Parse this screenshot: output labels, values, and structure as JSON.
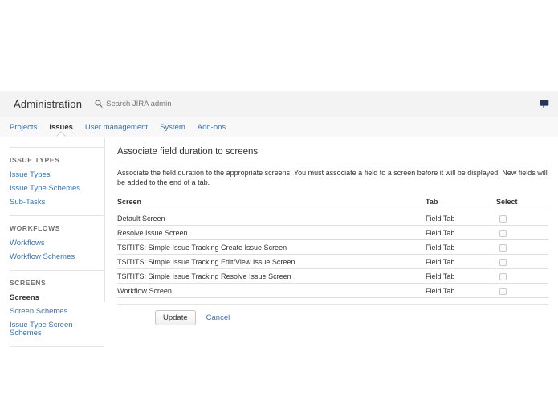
{
  "header": {
    "title": "Administration",
    "search_placeholder": "Search JIRA admin"
  },
  "nav": {
    "tabs": [
      {
        "label": "Projects",
        "active": false
      },
      {
        "label": "Issues",
        "active": true
      },
      {
        "label": "User management",
        "active": false
      },
      {
        "label": "System",
        "active": false
      },
      {
        "label": "Add-ons",
        "active": false
      }
    ]
  },
  "sidebar": {
    "sections": [
      {
        "title": "ISSUE TYPES",
        "items": [
          {
            "label": "Issue Types",
            "active": false
          },
          {
            "label": "Issue Type Schemes",
            "active": false
          },
          {
            "label": "Sub-Tasks",
            "active": false
          }
        ]
      },
      {
        "title": "WORKFLOWS",
        "items": [
          {
            "label": "Workflows",
            "active": false
          },
          {
            "label": "Workflow Schemes",
            "active": false
          }
        ]
      },
      {
        "title": "SCREENS",
        "items": [
          {
            "label": "Screens",
            "active": true
          },
          {
            "label": "Screen Schemes",
            "active": false
          },
          {
            "label": "Issue Type Screen Schemes",
            "active": false
          }
        ]
      }
    ]
  },
  "main": {
    "title": "Associate field duration to screens",
    "description": "Associate the field duration to the appropriate screens. You must associate a field to a screen before it will be displayed. New fields will be added to the end of a tab.",
    "table": {
      "headers": [
        "Screen",
        "Tab",
        "Select"
      ],
      "rows": [
        {
          "screen": "Default Screen",
          "tab": "Field Tab",
          "selected": false
        },
        {
          "screen": "Resolve Issue Screen",
          "tab": "Field Tab",
          "selected": false
        },
        {
          "screen": "TSITITS: Simple Issue Tracking Create Issue Screen",
          "tab": "Field Tab",
          "selected": false
        },
        {
          "screen": "TSITITS: Simple Issue Tracking Edit/View Issue Screen",
          "tab": "Field Tab",
          "selected": false
        },
        {
          "screen": "TSITITS: Simple Issue Tracking Resolve Issue Screen",
          "tab": "Field Tab",
          "selected": false
        },
        {
          "screen": "Workflow Screen",
          "tab": "Field Tab",
          "selected": false
        }
      ]
    },
    "buttons": {
      "update": "Update",
      "cancel": "Cancel"
    }
  },
  "icons": {
    "search": "search-icon",
    "feedback": "feedback-bubble-icon"
  },
  "colors": {
    "link_blue": "#3572b0",
    "feedback_icon": "#253858",
    "header_band": "#f3f3f3",
    "nav_band": "#f8f8f8"
  }
}
